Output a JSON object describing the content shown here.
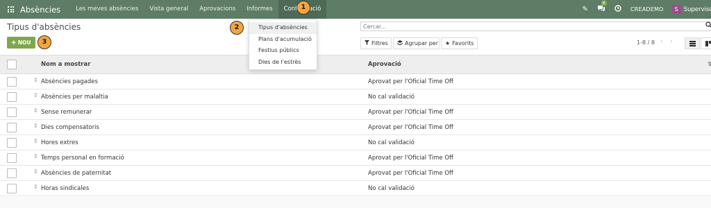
{
  "navbar": {
    "app_title": "Absències",
    "menu": [
      "Les meves absències",
      "Vista general",
      "Aprovacions",
      "Informes",
      "Configuració"
    ],
    "chat_count": "6",
    "company": "CREADEMO",
    "user_initial": "S",
    "user_name": "Supervisor"
  },
  "page": {
    "title": "Tipus d'absències",
    "new_button": "NOU",
    "search_placeholder": "Cercar...",
    "filters": "Filtres",
    "group_by": "Agrupar per",
    "favorites": "Favorits",
    "pager": "1-8 / 8"
  },
  "dropdown": {
    "items": [
      "Tipus d'absències",
      "Plans d'acumulació",
      "Festius públics",
      "Dies de l'estrès"
    ]
  },
  "callouts": [
    "1",
    "2",
    "3"
  ],
  "table": {
    "columns": [
      "Nom a mostrar",
      "Aprovació"
    ],
    "rows": [
      {
        "name": "Absències pagades",
        "approval": "Aprovat per l'Oficial Time Off"
      },
      {
        "name": "Absències per malaltia",
        "approval": "No cal validació"
      },
      {
        "name": "Sense remunerar",
        "approval": "Aprovat per l'Oficial Time Off"
      },
      {
        "name": "Dies compensatoris",
        "approval": "Aprovat per l'Oficial Time Off"
      },
      {
        "name": "Hores extres",
        "approval": "No cal validació"
      },
      {
        "name": "Temps personal en formació",
        "approval": "Aprovat per l'Oficial Time Off"
      },
      {
        "name": "Absències de paternitat",
        "approval": "Aprovat per l'Oficial Time Off"
      },
      {
        "name": "Horas sindicales",
        "approval": "No cal validació"
      }
    ]
  },
  "colors": {
    "navbar": "#5e7c66",
    "primary_button": "#7ea84a",
    "callout": "#f4a640",
    "avatar": "#9c4c8e"
  }
}
